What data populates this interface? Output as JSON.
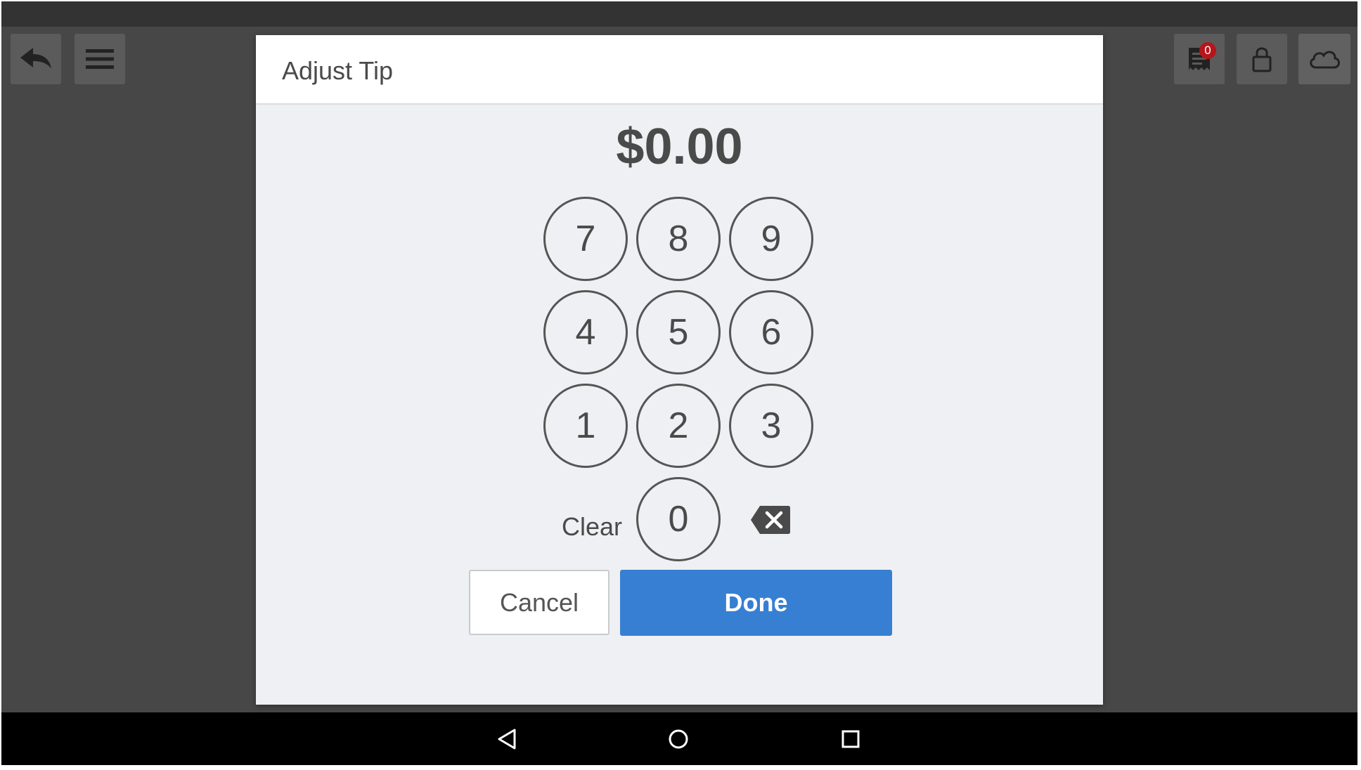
{
  "colors": {
    "background_dim": "#474747",
    "status_bar": "#333333",
    "dialog_bg": "#eff0f3",
    "accent": "#377fd2",
    "badge": "#b5161b",
    "text": "#4a4a4a"
  },
  "toolbar": {
    "back_icon": "back-arrow-icon",
    "menu_icon": "hamburger-menu-icon",
    "receipt_icon": "receipt-icon",
    "receipt_badge": "0",
    "lock_icon": "lock-icon",
    "cloud_icon": "cloud-icon"
  },
  "dialog": {
    "title": "Adjust Tip",
    "amount": "$0.00",
    "keypad": {
      "rows": [
        [
          "7",
          "8",
          "9"
        ],
        [
          "4",
          "5",
          "6"
        ],
        [
          "1",
          "2",
          "3"
        ]
      ],
      "zero": "0",
      "clear_label": "Clear",
      "backspace_icon": "backspace-icon"
    },
    "cancel_label": "Cancel",
    "done_label": "Done"
  },
  "navbar": {
    "back_icon": "nav-back-icon",
    "home_icon": "nav-home-icon",
    "recents_icon": "nav-recents-icon"
  }
}
